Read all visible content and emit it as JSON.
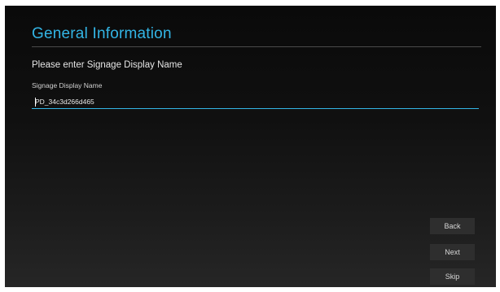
{
  "header": {
    "title": "General Information"
  },
  "form": {
    "prompt": "Please enter Signage Display Name",
    "field_label": "Signage Display Name",
    "field_value": "PD_34c3d266d465"
  },
  "buttons": {
    "back": "Back",
    "next": "Next",
    "skip": "Skip"
  },
  "colors": {
    "accent": "#33b5e5",
    "background": "#101010",
    "button": "#2e2e2e"
  }
}
